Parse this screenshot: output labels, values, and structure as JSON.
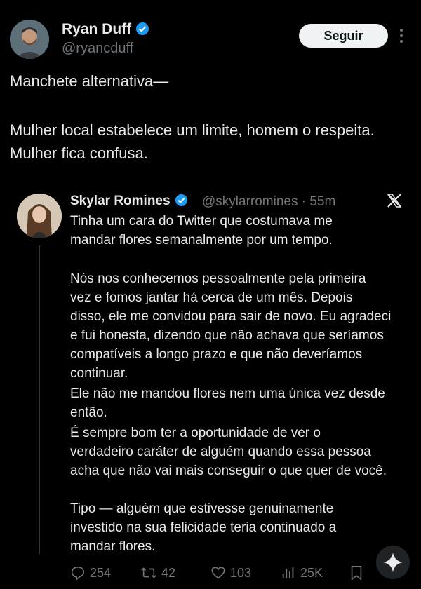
{
  "author": {
    "name": "Ryan Duff",
    "handle": "@ryancduff"
  },
  "follow_label": "Seguir",
  "tweet_lines": [
    "Manchete alternativa—",
    "Mulher local estabelece um limite, homem o respeita.",
    "Mulher fica confusa."
  ],
  "quoted": {
    "name": "Skylar Romines",
    "meta": "@skylarromines · 55m",
    "lines": [
      "Tinha um cara do Twitter que costumava me",
      "mandar flores semanalmente por um tempo.",
      "Nós nos conhecemos pessoalmente pela primeira",
      "vez e fomos jantar há cerca de um mês. Depois",
      "disso, ele me convidou para sair de novo. Eu agradeci",
      "e fui honesta, dizendo que não achava que seríamos",
      "compatíveis a longo prazo e que não deveríamos",
      "continuar.",
      "Ele não me mandou flores nem uma única vez desde",
      "então.",
      "É sempre bom ter a oportunidade de ver o",
      "verdadeiro caráter de alguém quando essa pessoa",
      "acha que não vai mais conseguir o que quer de você.",
      "Tipo — alguém que estivesse genuinamente",
      "investido na sua felicidade teria continuado a",
      "mandar flores."
    ]
  },
  "stats": {
    "replies": "254",
    "retweets": "42",
    "likes": "103",
    "views": "25K"
  },
  "icons": {
    "verified": "verified-badge-icon",
    "x_logo": "x-logo-icon",
    "reply": "reply-icon",
    "retweet": "retweet-icon",
    "like": "heart-icon",
    "views": "views-icon",
    "bookmark": "bookmark-icon",
    "grok": "sparkle-icon"
  },
  "colors": {
    "background": "#000000",
    "text": "#e7e9ea",
    "muted": "#71767b",
    "verified": "#1d9bf0"
  }
}
